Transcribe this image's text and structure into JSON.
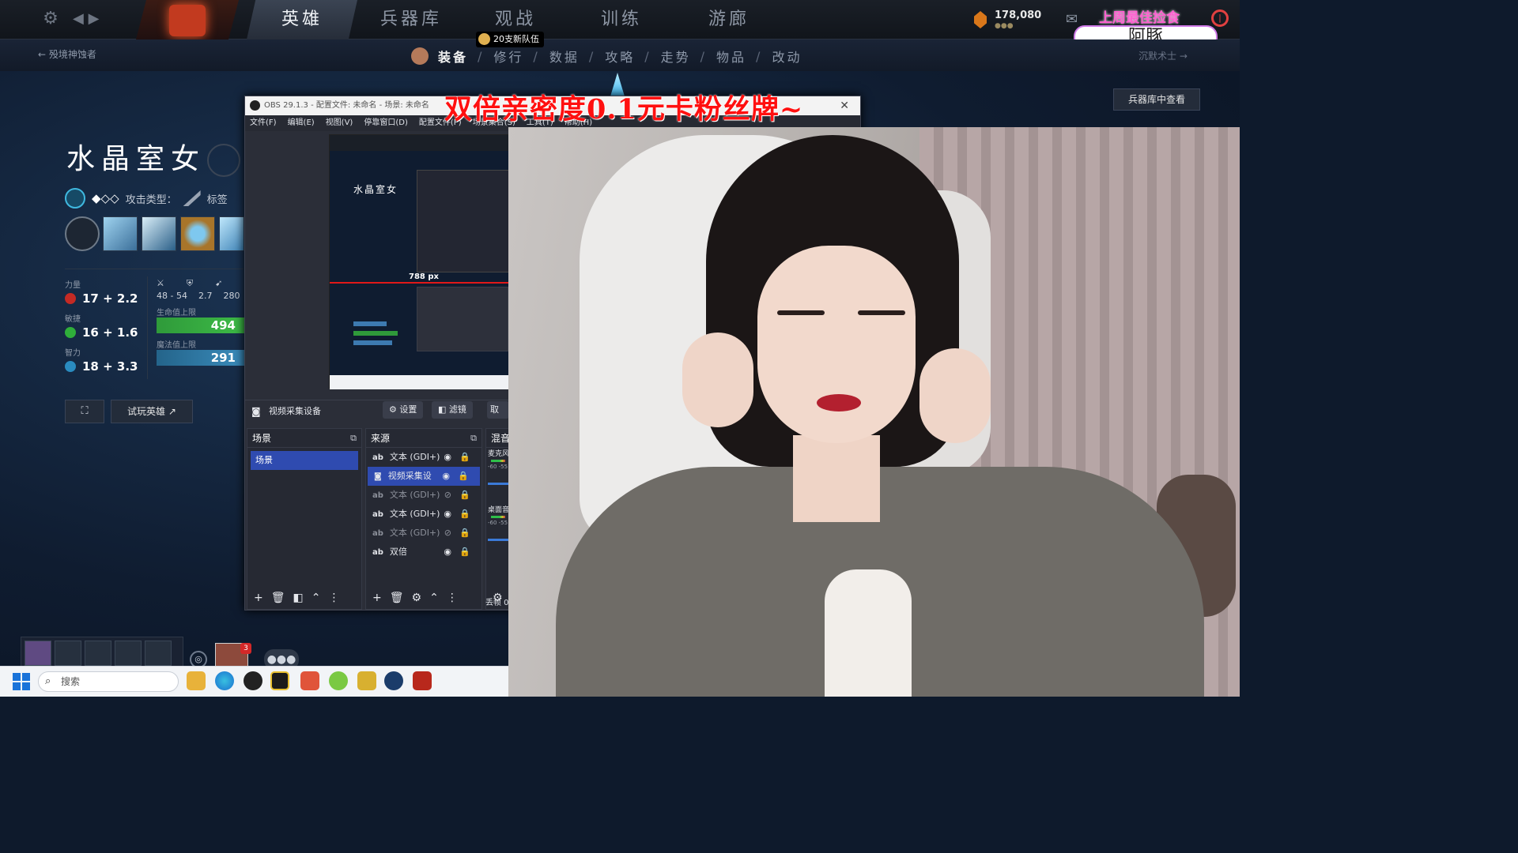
{
  "game": {
    "tabs": [
      "英雄",
      "兵器库",
      "观战",
      "训练",
      "游廊"
    ],
    "active_tab": "英雄",
    "currency": "178,080",
    "back_label": "殁境神蚀者",
    "next_label": "沉默术士",
    "subnav": [
      "装备",
      "修行",
      "数据",
      "攻略",
      "走势",
      "物品",
      "改动"
    ],
    "subnav_active": "装备",
    "team_badge": "20支新队伍",
    "armory_button": "兵器库中查看",
    "hero_name": "水晶室女",
    "attack_type_label": "攻击类型：",
    "tags_label": "标签",
    "complexity": "◆◇◇",
    "stats": {
      "str_label": "力量",
      "str_value": "17 + 2.2",
      "agi_label": "敏捷",
      "agi_value": "16 + 1.6",
      "int_label": "智力",
      "int_value": "18 + 3.3",
      "damage": "48 - 54",
      "armor": "2.7",
      "speed": "280",
      "hp_label": "生命值上限",
      "hp_value": "494",
      "mana_label": "魔法值上限",
      "mana_value": "291"
    },
    "try_hero": "试玩英雄",
    "friend_badge": "3"
  },
  "stream": {
    "promo_text": "上周最佳捡食",
    "streamer_name": "阿豚",
    "overlay_text": "双倍亲密度0.1元卡粉丝牌~"
  },
  "obs": {
    "title": "OBS 29.1.3 - 配置文件: 未命名 - 场景: 未命名",
    "menu": [
      "文件(F)",
      "编辑(E)",
      "视图(V)",
      "停靠窗口(D)",
      "配置文件(P)",
      "场景集合(S)",
      "工具(T)",
      "帮助(H)"
    ],
    "preview_hero": "水晶室女",
    "preview_px": "788 px",
    "source_label": "视频采集设备",
    "btn_settings": "设置",
    "btn_filters": "滤镜",
    "btn_cancel": "取消",
    "scenes_header": "场景",
    "scene_item": "场景",
    "sources_header": "来源",
    "mixer_header": "混音",
    "sources": [
      {
        "type": "ab",
        "name": "文本 (GDI+)"
      },
      {
        "type": "cam",
        "name": "视频采集设"
      },
      {
        "type": "ab",
        "name": "文本 (GDI+)"
      },
      {
        "type": "ab",
        "name": "文本 (GDI+)"
      },
      {
        "type": "ab",
        "name": "文本 (GDI+)"
      },
      {
        "type": "ab",
        "name": "双倍"
      }
    ],
    "mixer_mic": "麦克风",
    "mixer_desktop": "桌面音",
    "mixer_scale": "-60 -55",
    "dropped": "丢帧 0"
  },
  "taskbar": {
    "search_placeholder": "搜索"
  },
  "colors": {
    "hp_bar": "#2f9a3a",
    "mana_bar": "#2a6f96",
    "accent_obs": "#2f4bb0",
    "overlay_red": "#ff1010"
  }
}
